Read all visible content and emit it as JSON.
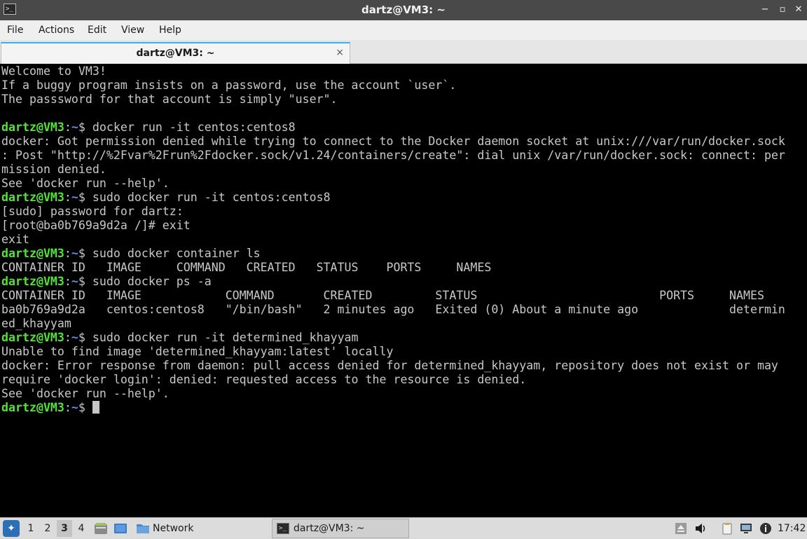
{
  "window": {
    "title": "dartz@VM3: ~",
    "min_glyph": "−",
    "max_glyph": "▫",
    "close_glyph": "✕"
  },
  "menu": {
    "file": "File",
    "actions": "Actions",
    "edit": "Edit",
    "view": "View",
    "help": "Help"
  },
  "tab": {
    "label": "dartz@VM3: ~",
    "close_glyph": "×"
  },
  "terminal": {
    "prompt_user": "dartz@VM3",
    "prompt_colon": ":",
    "prompt_path": "~",
    "prompt_symbol": "$ ",
    "lines": [
      {
        "type": "out",
        "text": "Welcome to VM3!"
      },
      {
        "type": "out",
        "text": "If a buggy program insists on a password, use the account `user`."
      },
      {
        "type": "out",
        "text": "The passsword for that account is simply \"user\"."
      },
      {
        "type": "out",
        "text": ""
      },
      {
        "type": "cmd",
        "text": "docker run -it centos:centos8"
      },
      {
        "type": "out",
        "text": "docker: Got permission denied while trying to connect to the Docker daemon socket at unix:///var/run/docker.sock"
      },
      {
        "type": "out",
        "text": ": Post \"http://%2Fvar%2Frun%2Fdocker.sock/v1.24/containers/create\": dial unix /var/run/docker.sock: connect: per"
      },
      {
        "type": "out",
        "text": "mission denied."
      },
      {
        "type": "out",
        "text": "See 'docker run --help'."
      },
      {
        "type": "cmd",
        "text": "sudo docker run -it centos:centos8"
      },
      {
        "type": "out",
        "text": "[sudo] password for dartz:"
      },
      {
        "type": "out",
        "text": "[root@ba0b769a9d2a /]# exit"
      },
      {
        "type": "out",
        "text": "exit"
      },
      {
        "type": "cmd",
        "text": "sudo docker container ls"
      },
      {
        "type": "out",
        "text": "CONTAINER ID   IMAGE     COMMAND   CREATED   STATUS    PORTS     NAMES"
      },
      {
        "type": "cmd",
        "text": "sudo docker ps -a"
      },
      {
        "type": "out",
        "text": "CONTAINER ID   IMAGE            COMMAND       CREATED         STATUS                          PORTS     NAMES"
      },
      {
        "type": "out",
        "text": "ba0b769a9d2a   centos:centos8   \"/bin/bash\"   2 minutes ago   Exited (0) About a minute ago             determin"
      },
      {
        "type": "out",
        "text": "ed_khayyam"
      },
      {
        "type": "cmd",
        "text": "sudo docker run -it determined_khayyam"
      },
      {
        "type": "out",
        "text": "Unable to find image 'determined_khayyam:latest' locally"
      },
      {
        "type": "out",
        "text": "docker: Error response from daemon: pull access denied for determined_khayyam, repository does not exist or may"
      },
      {
        "type": "out",
        "text": "require 'docker login': denied: requested access to the resource is denied."
      },
      {
        "type": "out",
        "text": "See 'docker run --help'."
      },
      {
        "type": "cmd",
        "text": ""
      }
    ]
  },
  "taskbar": {
    "workspaces": [
      "1",
      "2",
      "3",
      "4"
    ],
    "active_workspace": "3",
    "network_label": "Network",
    "task_label": "dartz@VM3: ~",
    "clock": "17:42"
  },
  "colors": {
    "prompt_user": "#55e23a",
    "prompt_path": "#5b8df7",
    "terminal_bg": "#000000",
    "terminal_fg": "#c8c8c8",
    "titlebar_bg": "#494949",
    "tab_accent": "#3daee9"
  },
  "icons": {
    "app": "terminal-icon",
    "start": "lxqt-start-icon",
    "file_manager": "file-manager-icon",
    "desktop": "show-desktop-icon",
    "folder": "folder-icon",
    "eject": "eject-icon",
    "volume": "volume-icon",
    "clipboard": "clipboard-icon",
    "network_tray": "network-tray-icon",
    "info": "info-icon"
  }
}
